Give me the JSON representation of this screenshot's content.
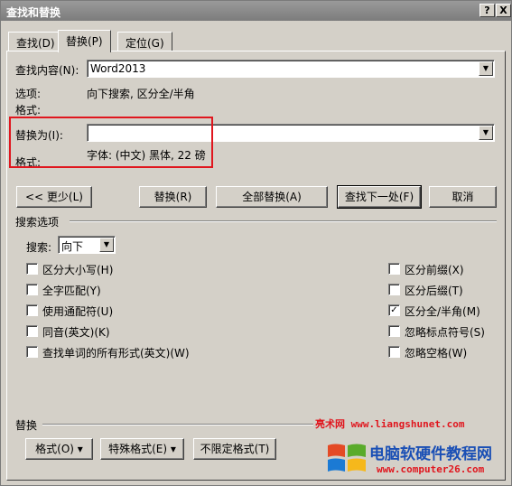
{
  "window": {
    "title": "查找和替换",
    "help_label": "?",
    "close_label": "X"
  },
  "tabs": [
    {
      "label": "查找(D)"
    },
    {
      "label": "替换(P)"
    },
    {
      "label": "定位(G)"
    }
  ],
  "find": {
    "label": "查找内容(N):",
    "value": "Word2013",
    "options_label": "选项:",
    "options_value": "向下搜索, 区分全/半角",
    "format_label": "格式:"
  },
  "replace": {
    "label": "替换为(I):",
    "value": "",
    "format_label": "格式:",
    "format_value": "字体: (中文) 黑体, 22 磅"
  },
  "buttons": {
    "less": "<< 更少(L)",
    "replace": "替换(R)",
    "replace_all": "全部替换(A)",
    "find_next": "查找下一处(F)",
    "cancel": "取消"
  },
  "search_options": {
    "section_label": "搜索选项",
    "search_label": "搜索:",
    "search_value": "向下",
    "left_checks": [
      {
        "label": "区分大小写(H)",
        "checked": false
      },
      {
        "label": "全字匹配(Y)",
        "checked": false
      },
      {
        "label": "使用通配符(U)",
        "checked": false
      },
      {
        "label": "同音(英文)(K)",
        "checked": false
      },
      {
        "label": "查找单词的所有形式(英文)(W)",
        "checked": false
      }
    ],
    "right_checks": [
      {
        "label": "区分前缀(X)",
        "checked": false
      },
      {
        "label": "区分后缀(T)",
        "checked": false
      },
      {
        "label": "区分全/半角(M)",
        "checked": true
      },
      {
        "label": "忽略标点符号(S)",
        "checked": false
      },
      {
        "label": "忽略空格(W)",
        "checked": false
      }
    ]
  },
  "replace_section": {
    "label": "替换",
    "format_button": "格式(O) ▾",
    "special_button": "特殊格式(E) ▾",
    "no_format_button": "不限定格式(T)"
  },
  "watermark": {
    "line1": "亮术网 www.liangshunet.com",
    "line2": "电脑软硬件教程网",
    "line3": "www.computer26.com",
    "red": "#e0161e",
    "blue": "#1a4fb5"
  }
}
